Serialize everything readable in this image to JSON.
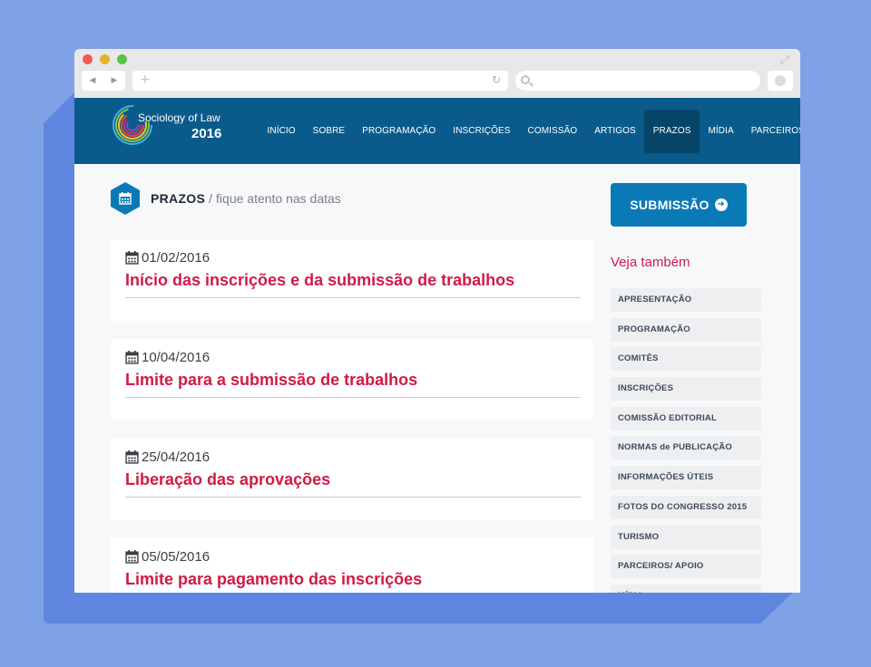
{
  "browser": {
    "back_icon": "◀",
    "forward_icon": "▶",
    "newtab_icon": "+",
    "reload_icon": "↻",
    "expand_icon": "⤢"
  },
  "site": {
    "logo_name": "Sociology of Law",
    "logo_year": "2016",
    "nav": [
      "INÍCIO",
      "SOBRE",
      "PROGRAMAÇÃO",
      "INSCRIÇÕES",
      "COMISSÃO",
      "ARTIGOS",
      "PRAZOS",
      "MÍDIA",
      "PARCEIROS"
    ],
    "active_nav": "PRAZOS"
  },
  "page": {
    "title": "PRAZOS",
    "separator": "/",
    "subtitle": "fique atento nas datas"
  },
  "deadlines": [
    {
      "date": "01/02/2016",
      "title": "Início das inscrições e da submissão de trabalhos"
    },
    {
      "date": "10/04/2016",
      "title": "Limite para a submissão de trabalhos"
    },
    {
      "date": "25/04/2016",
      "title": "Liberação das aprovações"
    },
    {
      "date": "05/05/2016",
      "title": "Limite para pagamento das inscrições"
    }
  ],
  "sidebar": {
    "submit_label": "SUBMISSÃO",
    "submit_arrow": "➜",
    "see_also": "Veja também",
    "links": [
      "APRESENTAÇÃO",
      "PROGRAMAÇÃO",
      "COMITÊS",
      "INSCRIÇÕES",
      "COMISSÃO EDITORIAL",
      "NORMAS de PUBLICAÇÃO",
      "INFORMAÇÕES ÚTEIS",
      "FOTOS DO CONGRESSO 2015",
      "TURISMO",
      "PARCEIROS/ APOIO",
      "MÍDIA"
    ]
  },
  "colors": {
    "header_bg": "#0a5b8c",
    "accent_blue": "#0a7ab6",
    "accent_red": "#d11a45",
    "page_bg": "#7fa2e6"
  }
}
